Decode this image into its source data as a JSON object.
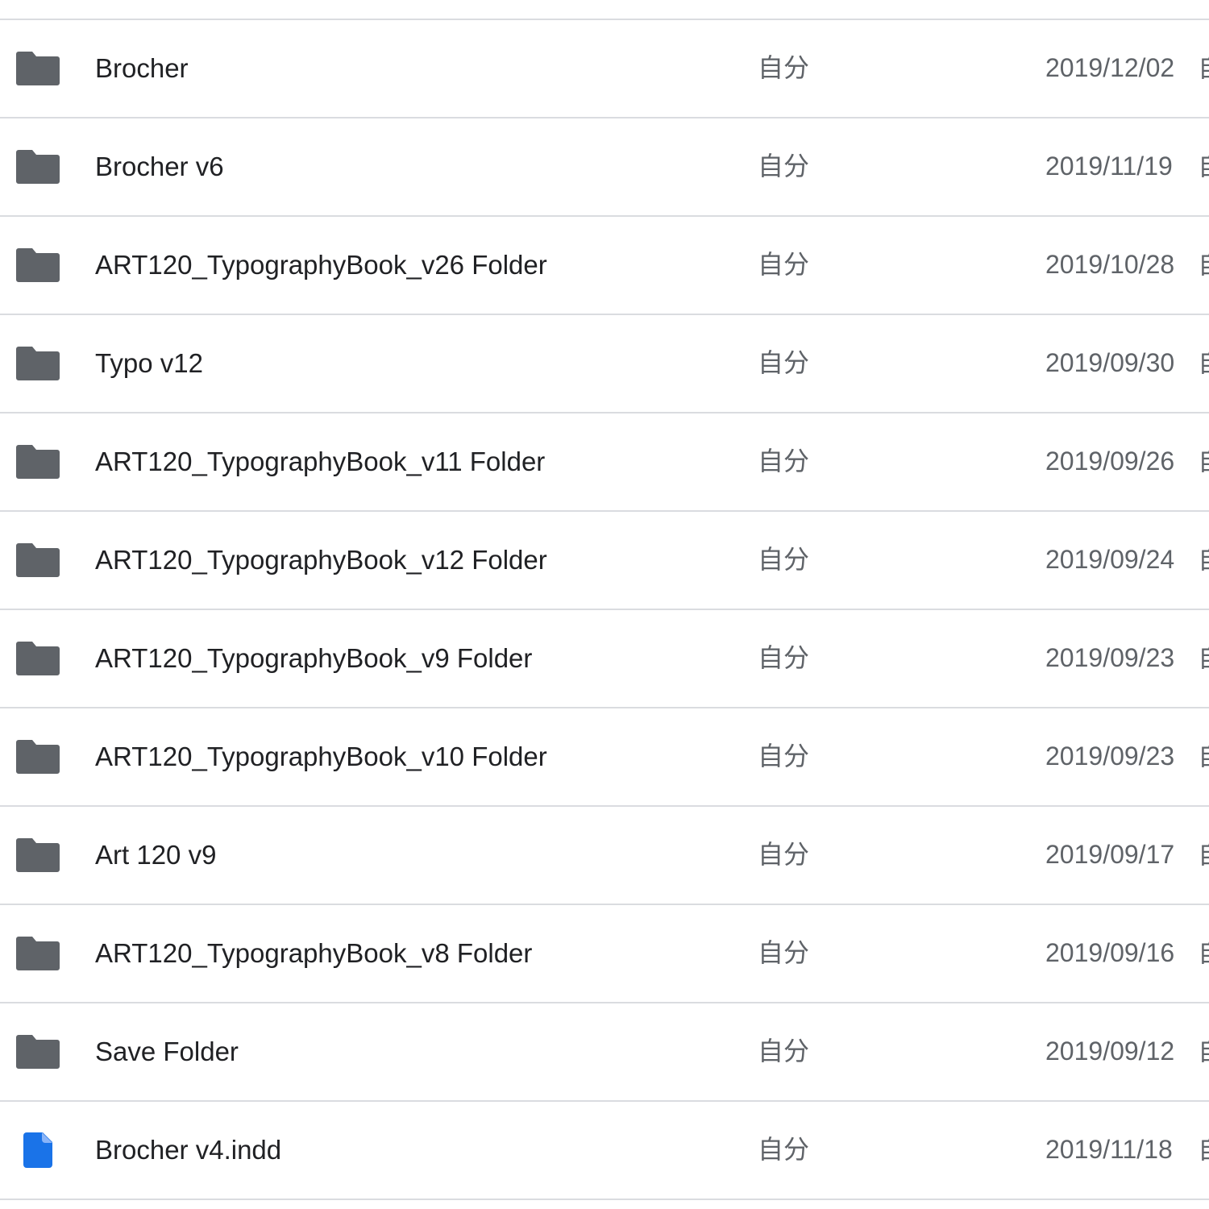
{
  "colors": {
    "folder_icon": "#5f6368",
    "file_icon": "#1a73e8",
    "divider": "#dadce0"
  },
  "rows": [
    {
      "icon": "folder-icon",
      "name": "Brocher",
      "owner": "自分",
      "date": "2019/12/02",
      "next_col": "自"
    },
    {
      "icon": "folder-icon",
      "name": "Brocher v6",
      "owner": "自分",
      "date": "2019/11/19",
      "next_col": "自"
    },
    {
      "icon": "folder-icon",
      "name": "ART120_TypographyBook_v26 Folder",
      "owner": "自分",
      "date": "2019/10/28",
      "next_col": "自"
    },
    {
      "icon": "folder-icon",
      "name": "Typo v12",
      "owner": "自分",
      "date": "2019/09/30",
      "next_col": "自"
    },
    {
      "icon": "folder-icon",
      "name": "ART120_TypographyBook_v11 Folder",
      "owner": "自分",
      "date": "2019/09/26",
      "next_col": "自"
    },
    {
      "icon": "folder-icon",
      "name": "ART120_TypographyBook_v12 Folder",
      "owner": "自分",
      "date": "2019/09/24",
      "next_col": "自"
    },
    {
      "icon": "folder-icon",
      "name": "ART120_TypographyBook_v9 Folder",
      "owner": "自分",
      "date": "2019/09/23",
      "next_col": "自"
    },
    {
      "icon": "folder-icon",
      "name": "ART120_TypographyBook_v10 Folder",
      "owner": "自分",
      "date": "2019/09/23",
      "next_col": "自"
    },
    {
      "icon": "folder-icon",
      "name": "Art 120 v9",
      "owner": "自分",
      "date": "2019/09/17",
      "next_col": "自"
    },
    {
      "icon": "folder-icon",
      "name": "ART120_TypographyBook_v8 Folder",
      "owner": "自分",
      "date": "2019/09/16",
      "next_col": "自"
    },
    {
      "icon": "folder-icon",
      "name": "Save Folder",
      "owner": "自分",
      "date": "2019/09/12",
      "next_col": "自"
    },
    {
      "icon": "file-icon",
      "name": "Brocher v4.indd",
      "owner": "自分",
      "date": "2019/11/18",
      "next_col": "自"
    }
  ]
}
